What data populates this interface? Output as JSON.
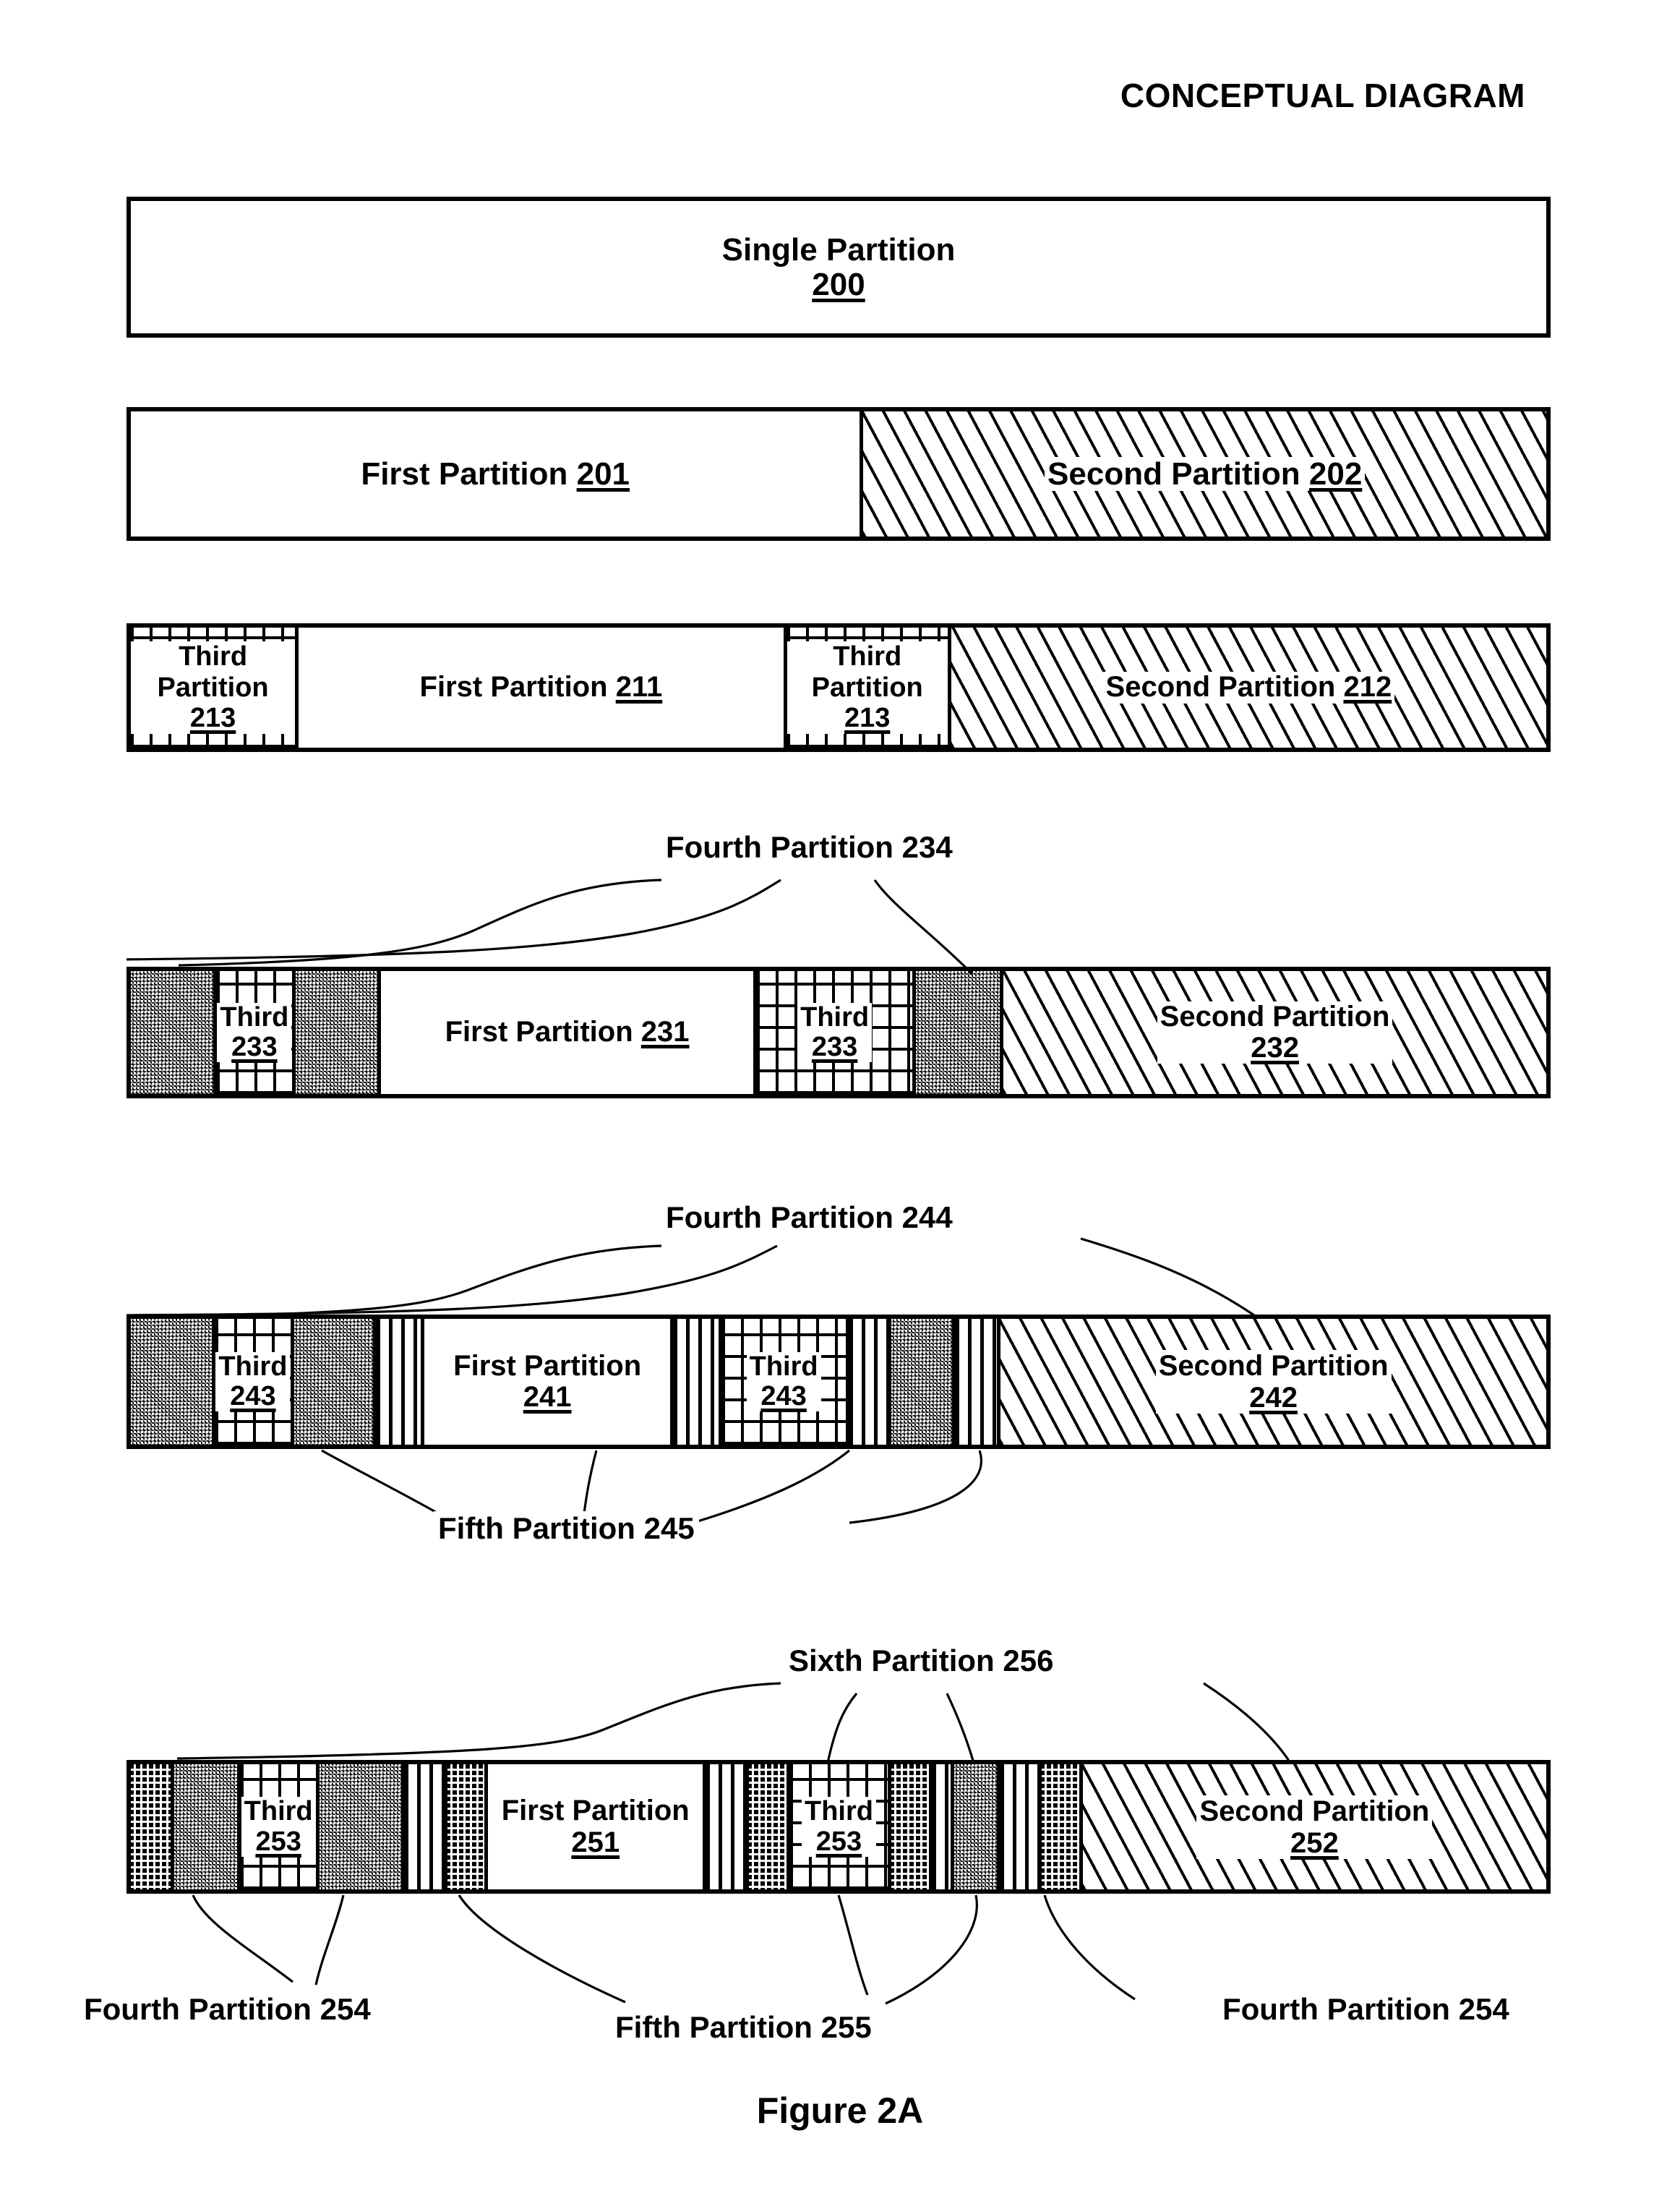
{
  "header": {
    "title": "CONCEPTUAL DIAGRAM"
  },
  "figure": {
    "caption": "Figure 2A"
  },
  "rows": [
    {
      "id": "row-single",
      "segments": [
        {
          "name": "single-partition-200",
          "fill": "plain",
          "title": "Single Partition",
          "number": "200",
          "layout": "two-line"
        }
      ]
    },
    {
      "id": "row-two",
      "segments": [
        {
          "name": "first-partition-201",
          "fill": "plain",
          "title": "First Partition",
          "number": "201",
          "layout": "inline"
        },
        {
          "name": "second-partition-202",
          "fill": "diag",
          "title": "Second Partition",
          "number": "202",
          "layout": "inline"
        }
      ]
    },
    {
      "id": "row-three",
      "segments": [
        {
          "name": "third-partition-213-a",
          "fill": "grid",
          "title": "Third Partition",
          "number": "213",
          "layout": "stacked"
        },
        {
          "name": "first-partition-211",
          "fill": "plain",
          "title": "First Partition",
          "number": "211",
          "layout": "inline"
        },
        {
          "name": "third-partition-213-b",
          "fill": "grid",
          "title": "Third Partition",
          "number": "213",
          "layout": "stacked"
        },
        {
          "name": "second-partition-212",
          "fill": "diag",
          "title": "Second Partition",
          "number": "212",
          "layout": "inline"
        }
      ]
    },
    {
      "id": "row-four",
      "callout_top": "Fourth Partition 234",
      "segments": [
        {
          "name": "fourth-partition-234-a",
          "fill": "stipple",
          "title": "",
          "number": "",
          "layout": "none"
        },
        {
          "name": "third-partition-233-a",
          "fill": "grid",
          "title": "Third",
          "number": "233",
          "layout": "two-line"
        },
        {
          "name": "fourth-partition-234-b",
          "fill": "stipple",
          "title": "",
          "number": "",
          "layout": "none"
        },
        {
          "name": "first-partition-231",
          "fill": "plain",
          "title": "First Partition",
          "number": "231",
          "layout": "inline"
        },
        {
          "name": "third-partition-233-b",
          "fill": "grid",
          "title": "Third",
          "number": "233",
          "layout": "two-line"
        },
        {
          "name": "fourth-partition-234-c",
          "fill": "stipple",
          "title": "",
          "number": "",
          "layout": "none"
        },
        {
          "name": "second-partition-232",
          "fill": "diag",
          "title": "Second Partition",
          "number": "232",
          "layout": "two-line"
        }
      ]
    },
    {
      "id": "row-five",
      "callout_top": "Fourth Partition 244",
      "callout_bottom": "Fifth Partition 245",
      "segments": [
        {
          "name": "fourth-partition-244-a",
          "fill": "stipple",
          "title": "",
          "number": "",
          "layout": "none"
        },
        {
          "name": "third-partition-243-a",
          "fill": "grid",
          "title": "Third",
          "number": "243",
          "layout": "two-line"
        },
        {
          "name": "fourth-partition-244-b",
          "fill": "stipple",
          "title": "",
          "number": "",
          "layout": "none"
        },
        {
          "name": "fifth-partition-245-a",
          "fill": "vstripe",
          "title": "",
          "number": "",
          "layout": "none"
        },
        {
          "name": "first-partition-241",
          "fill": "plain",
          "title": "First Partition",
          "number": "241",
          "layout": "two-line"
        },
        {
          "name": "fifth-partition-245-b",
          "fill": "vstripe",
          "title": "",
          "number": "",
          "layout": "none"
        },
        {
          "name": "third-partition-243-b",
          "fill": "grid",
          "title": "Third",
          "number": "243",
          "layout": "two-line"
        },
        {
          "name": "fifth-partition-245-c",
          "fill": "vstripe",
          "title": "",
          "number": "",
          "layout": "none"
        },
        {
          "name": "fourth-partition-244-c",
          "fill": "stipple",
          "title": "",
          "number": "",
          "layout": "none"
        },
        {
          "name": "fifth-partition-245-d",
          "fill": "vstripe",
          "title": "",
          "number": "",
          "layout": "none"
        },
        {
          "name": "second-partition-242",
          "fill": "diag",
          "title": "Second Partition",
          "number": "242",
          "layout": "three-line"
        }
      ]
    },
    {
      "id": "row-six",
      "callout_top": "Sixth Partition 256",
      "callout_bottom_left": "Fourth Partition 254",
      "callout_bottom_center": "Fifth Partition 255",
      "callout_bottom_right": "Fourth Partition 254",
      "segments": [
        {
          "name": "sixth-partition-256-a",
          "fill": "dark",
          "title": "",
          "number": "",
          "layout": "none"
        },
        {
          "name": "fourth-partition-254-a",
          "fill": "stipple",
          "title": "",
          "number": "",
          "layout": "none"
        },
        {
          "name": "third-partition-253-a",
          "fill": "grid",
          "title": "Third",
          "number": "253",
          "layout": "two-line"
        },
        {
          "name": "fourth-partition-254-b",
          "fill": "stipple",
          "title": "",
          "number": "",
          "layout": "none"
        },
        {
          "name": "fifth-partition-255-a",
          "fill": "vstripe",
          "title": "",
          "number": "",
          "layout": "none"
        },
        {
          "name": "sixth-partition-256-b",
          "fill": "dark",
          "title": "",
          "number": "",
          "layout": "none"
        },
        {
          "name": "first-partition-251",
          "fill": "plain",
          "title": "First Partition",
          "number": "251",
          "layout": "two-line"
        },
        {
          "name": "fifth-partition-255-b",
          "fill": "vstripe",
          "title": "",
          "number": "",
          "layout": "none"
        },
        {
          "name": "sixth-partition-256-c",
          "fill": "dark",
          "title": "",
          "number": "",
          "layout": "none"
        },
        {
          "name": "third-partition-253-b",
          "fill": "grid",
          "title": "Third",
          "number": "253",
          "layout": "two-line"
        },
        {
          "name": "sixth-partition-256-d",
          "fill": "dark",
          "title": "",
          "number": "",
          "layout": "none"
        },
        {
          "name": "fifth-partition-255-c",
          "fill": "vstripe",
          "title": "",
          "number": "",
          "layout": "none"
        },
        {
          "name": "fourth-partition-254-c",
          "fill": "stipple",
          "title": "",
          "number": "",
          "layout": "none"
        },
        {
          "name": "fifth-partition-255-d",
          "fill": "vstripe",
          "title": "",
          "number": "",
          "layout": "none"
        },
        {
          "name": "sixth-partition-256-e",
          "fill": "dark",
          "title": "",
          "number": "",
          "layout": "none"
        },
        {
          "name": "second-partition-252",
          "fill": "diag",
          "title": "Second Partition",
          "number": "252",
          "layout": "three-line"
        }
      ]
    }
  ]
}
